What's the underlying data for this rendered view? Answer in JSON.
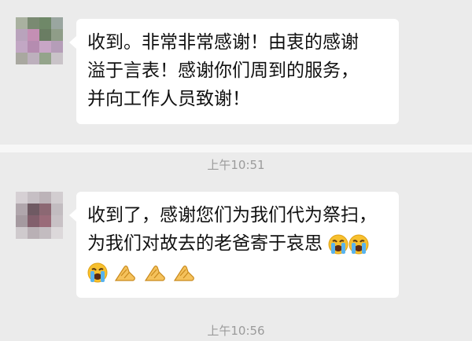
{
  "messages": [
    {
      "lines": [
        "收到。非常非常感谢！由衷的感谢",
        "溢于言表！感谢你们周到的服务，",
        "并向工作人员致谢！"
      ]
    },
    {
      "lines": [
        "收到了，感谢您们为我们代为祭扫，",
        "为我们对故去的老爸寄于哀思"
      ],
      "emoji_after_line2": [
        "loudly-crying-face",
        "loudly-crying-face"
      ],
      "emoji_line3": [
        "loudly-crying-face",
        "folded-hands",
        "folded-hands",
        "folded-hands"
      ]
    }
  ],
  "timestamps": [
    "上午10:51",
    "上午10:56"
  ],
  "colors": {
    "background": "#ebebeb",
    "bubble": "#ffffff",
    "timestamp": "#9b9b9b"
  }
}
